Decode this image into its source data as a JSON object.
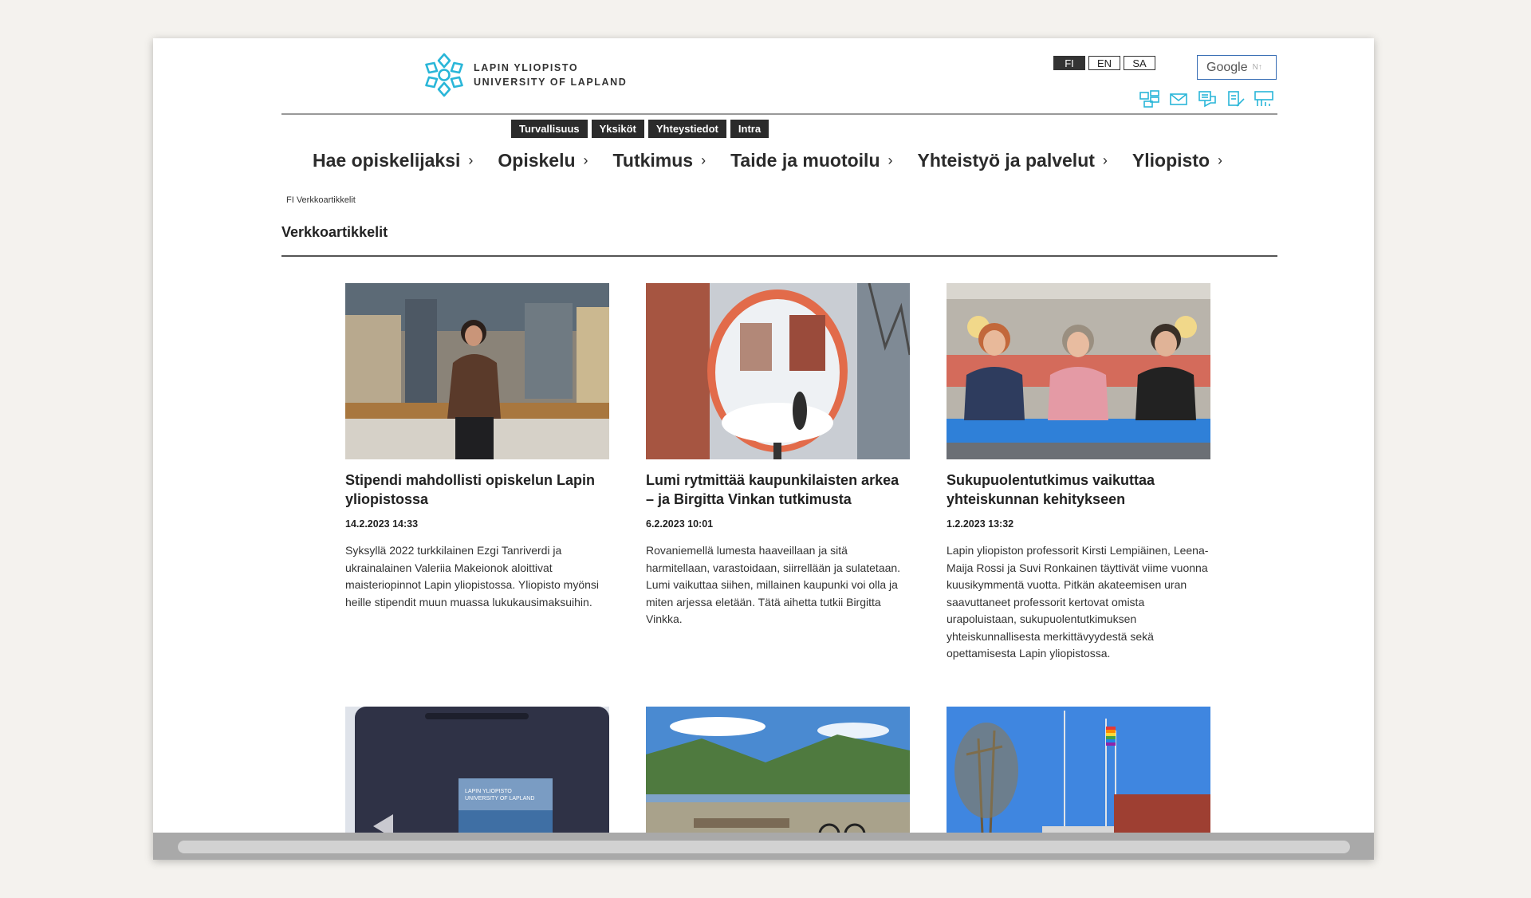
{
  "logo": {
    "line1": "LAPIN YLIOPISTO",
    "line2": "UNIVERSITY OF LAPLAND",
    "color": "#29b6d8"
  },
  "languages": [
    "FI",
    "EN",
    "SA"
  ],
  "active_language": "FI",
  "search": {
    "brand": "Google",
    "hint": "N↑"
  },
  "tool_icons": [
    "sitemap-icon",
    "mail-icon",
    "feedback-icon",
    "edit-icon",
    "stats-icon"
  ],
  "quick_links": [
    "Turvallisuus",
    "Yksiköt",
    "Yhteystiedot",
    "Intra"
  ],
  "nav": [
    {
      "label": "Hae opiskelijaksi"
    },
    {
      "label": "Opiskelu"
    },
    {
      "label": "Tutkimus"
    },
    {
      "label": "Taide ja muotoilu"
    },
    {
      "label": "Yhteistyö ja palvelut"
    },
    {
      "label": "Yliopisto"
    }
  ],
  "breadcrumb": "FI Verkkoartikkelit",
  "page_title": "Verkkoartikkelit",
  "articles": [
    {
      "title": "Stipendi mahdollisti opiskelun Lapin yliopistossa",
      "date": "14.2.2023 14:33",
      "text": "Syksyllä 2022 turkkilainen Ezgi Tanriverdi ja ukrainalainen Valeriia Makeionok aloittivat maisteriopinnot Lapin yliopistossa. Yliopisto myönsi heille stipendit muun muassa lukukausimaksuihin."
    },
    {
      "title": "Lumi rytmittää kaupunkilaisten arkea – ja Birgitta Vinkan tutkimusta",
      "date": "6.2.2023 10:01",
      "text": "Rovaniemellä lumesta haaveillaan ja sitä harmitellaan, varastoidaan, siirrellään ja sulatetaan. Lumi vaikuttaa siihen, millainen kaupunki voi olla ja miten arjessa eletään. Tätä aihetta tutkii Birgitta Vinkka."
    },
    {
      "title": "Sukupuolentutkimus vaikuttaa yhteiskunnan kehitykseen",
      "date": "1.2.2023 13:32",
      "text": "Lapin yliopiston professorit Kirsti Lempiäinen, Leena-Maija Rossi ja Suvi Ronkainen täyttivät viime vuonna kuusikymmentä vuotta. Pitkän akateemisen uran saavuttaneet professorit kertovat omista urapoluistaan, sukupuolentutkimuksen yhteiskunnallisesta merkittävyydestä sekä opettamisesta Lapin yliopistossa."
    }
  ],
  "lower_card_print": {
    "line1": "LAPIN YLIOPISTO",
    "line2": "UNIVERSITY OF LAPLAND"
  }
}
